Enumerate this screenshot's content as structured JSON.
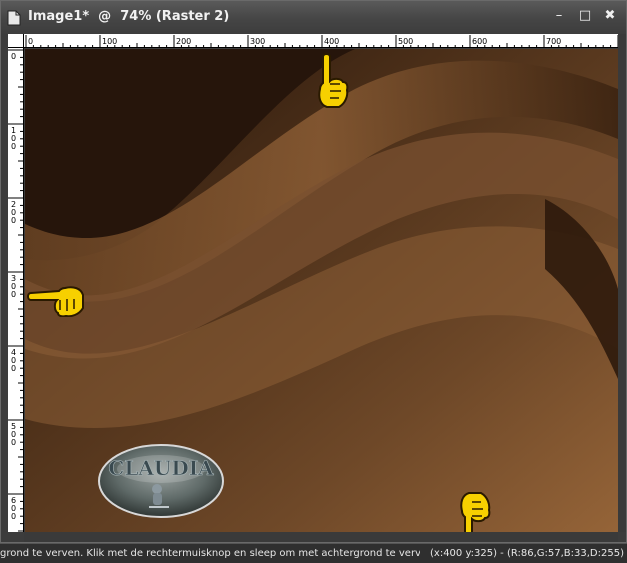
{
  "window": {
    "title": "Image1*  @  74% (Raster 2)",
    "icon": "document-icon",
    "minimize_glyph": "–",
    "maximize_glyph": "□",
    "close_glyph": "✖"
  },
  "rulers": {
    "horizontal_labels": [
      "0",
      "100",
      "200",
      "300",
      "400",
      "500",
      "600",
      "700"
    ],
    "vertical_labels": [
      "0",
      "100",
      "200",
      "300",
      "400",
      "500",
      "600"
    ]
  },
  "canvas": {
    "logo_text": "CLAUDIA",
    "colors": {
      "dark": "#2a180c",
      "mid": "#5a3920",
      "light": "#9a6a40"
    },
    "pointers": [
      "pointing-up-hand-icon",
      "pointing-right-hand-icon",
      "pointing-down-hand-icon"
    ]
  },
  "status": {
    "hint": "grond te verven. Klik met de rechtermuisknop en sleep om met achtergrond te verven.",
    "coords": "(x:400 y:325) - (R:86,G:57,B:33,D:255)"
  }
}
